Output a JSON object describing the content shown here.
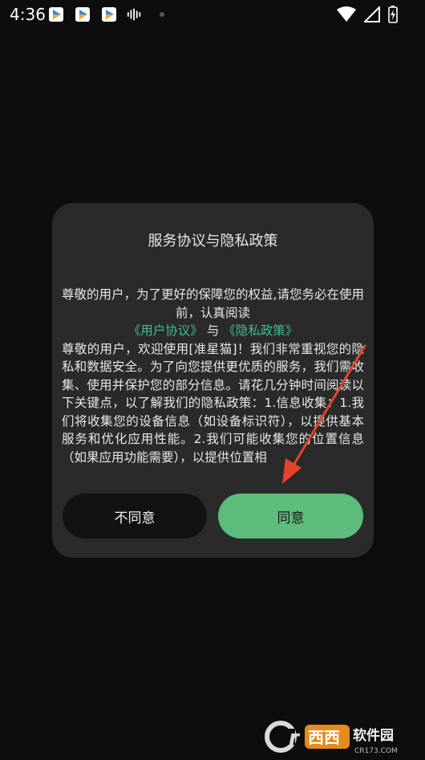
{
  "status_bar": {
    "time": "4:36"
  },
  "dialog": {
    "title": "服务协议与隐私政策",
    "intro": "尊敬的用户，为了更好的保障您的权益,请您务必在使用前，认真阅读",
    "link_user_agreement": "《用户协议》",
    "and_text": "与",
    "link_privacy_policy": "《隐私政策》",
    "body": "尊敬的用户，欢迎使用[准星猫]！我们非常重视您的隐私和数据安全。为了向您提供更优质的服务，我们需收集、使用并保护您的部分信息。请花几分钟时间阅读以下关键点，以了解我们的隐私政策：1.信息收集：1.我们将收集您的设备信息（如设备标识符），以提供基本服务和优化应用性能。2.我们可能收集您的位置信息（如果应用功能需要），以提供位置相",
    "disagree_label": "不同意",
    "agree_label": "同意"
  },
  "watermark": {
    "brand": "西西软件园",
    "site": "CR173.COM"
  },
  "colors": {
    "link": "#3fbf8f",
    "agree_button": "#5dbb7c",
    "arrow": "#e5432d"
  }
}
